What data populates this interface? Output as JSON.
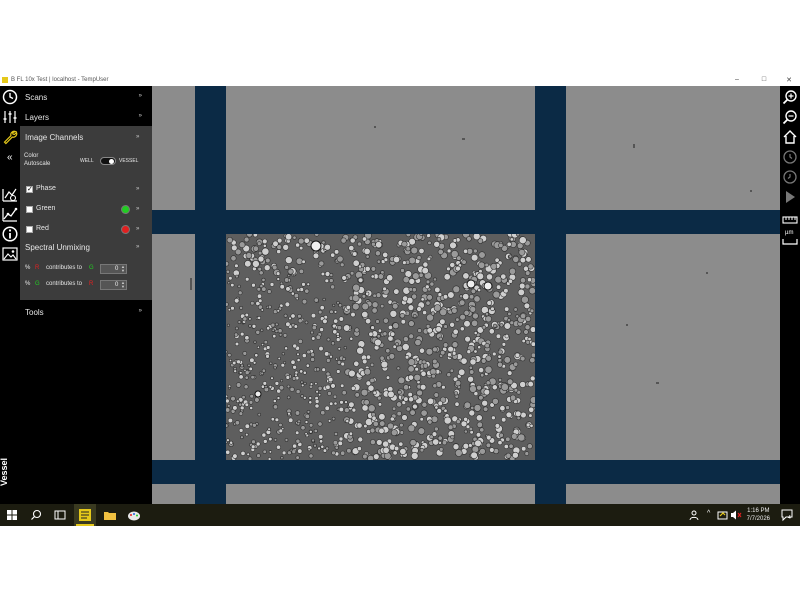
{
  "window": {
    "title": "B FL 10x Test | localhost - TempUser",
    "minimize": "–",
    "maximize": "□",
    "close": "✕"
  },
  "sidebar": {
    "collapse_glyph": "«",
    "items": [
      {
        "label": "Scans",
        "chevron": "»"
      },
      {
        "label": "Layers",
        "chevron": "»"
      },
      {
        "label": "Tools",
        "chevron": "»"
      }
    ],
    "vessel_label": "Vessel"
  },
  "image_channels": {
    "title": "Image Channels",
    "chevron": "»",
    "color_autoscale_label": "Color\nAutoscale",
    "toggle_left": "WELL",
    "toggle_right": "VESSEL",
    "toggle_value": "VESSEL",
    "channels": [
      {
        "label": "Phase",
        "checked": true,
        "dot_color": null,
        "chevron": "»"
      },
      {
        "label": "Green",
        "checked": false,
        "dot_color": "#22cc22",
        "chevron": "»"
      },
      {
        "label": "Red",
        "checked": false,
        "dot_color": "#e02020",
        "chevron": "»"
      }
    ]
  },
  "spectral_unmixing": {
    "title": "Spectral Unmixing",
    "chevron": "»",
    "rows": [
      {
        "pct": "%",
        "from": "R",
        "from_color": "#e02020",
        "mid": "contributes to",
        "to": "G",
        "to_color": "#22cc22",
        "value": "0"
      },
      {
        "pct": "%",
        "from": "G",
        "from_color": "#22cc22",
        "mid": "contributes to",
        "to": "R",
        "to_color": "#e02020",
        "value": "0"
      }
    ]
  },
  "right_toolbar": {
    "icons": [
      "zoom-in-icon",
      "zoom-out-icon",
      "home-icon",
      "history-forward-icon",
      "history-back-icon",
      "play-icon",
      "ruler-icon",
      "micron-scale-icon"
    ],
    "micron_label": "µm"
  },
  "taskbar": {
    "time": "1:16 PM",
    "date": "7/7/2026",
    "notification_count": "4"
  },
  "colors": {
    "viewer_background": "#8c8c8c",
    "grid_bands": "#0b2a45",
    "sidebar_background": "#000000",
    "panel_background": "#3c3c3c",
    "accent_wrench": "#e5c81a"
  }
}
